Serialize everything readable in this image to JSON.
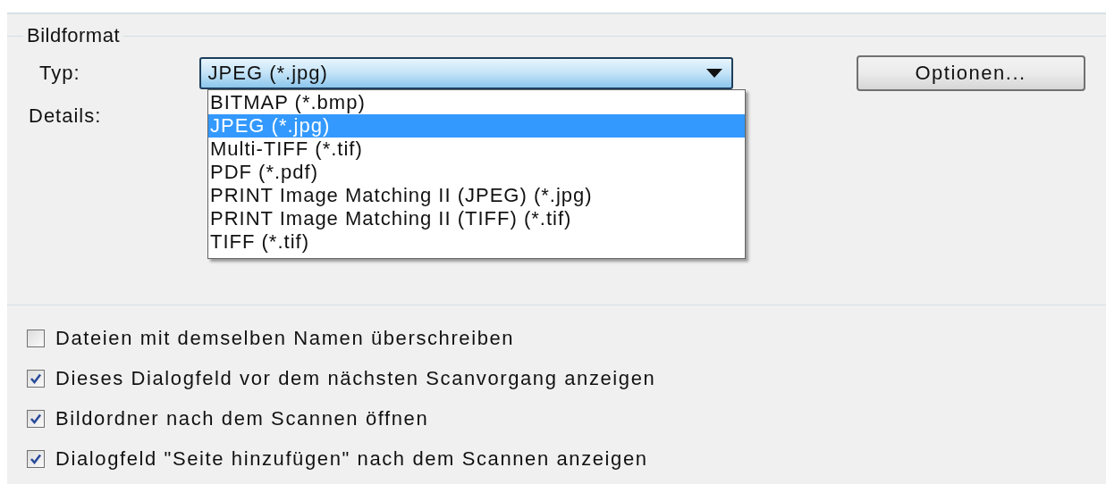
{
  "group": {
    "title": "Bildformat"
  },
  "type_field": {
    "label": "Typ:",
    "value": "JPEG (*.jpg)",
    "expanded": true
  },
  "options_button": "Optionen...",
  "details": {
    "label": "Details:"
  },
  "dropdown_items": [
    {
      "label": "BITMAP (*.bmp)",
      "selected": false
    },
    {
      "label": "JPEG (*.jpg)",
      "selected": true
    },
    {
      "label": "Multi-TIFF (*.tif)",
      "selected": false
    },
    {
      "label": "PDF (*.pdf)",
      "selected": false
    },
    {
      "label": "PRINT Image Matching II (JPEG) (*.jpg)",
      "selected": false
    },
    {
      "label": "PRINT Image Matching II (TIFF) (*.tif)",
      "selected": false
    },
    {
      "label": "TIFF (*.tif)",
      "selected": false
    }
  ],
  "checkboxes": [
    {
      "label": "Dateien mit demselben Namen überschreiben",
      "checked": false
    },
    {
      "label": "Dieses Dialogfeld vor dem nächsten Scanvorgang anzeigen",
      "checked": true
    },
    {
      "label": "Bildordner nach dem Scannen öffnen",
      "checked": true
    },
    {
      "label": "Dialogfeld \"Seite hinzufügen\" nach dem Scannen anzeigen",
      "checked": true
    }
  ]
}
